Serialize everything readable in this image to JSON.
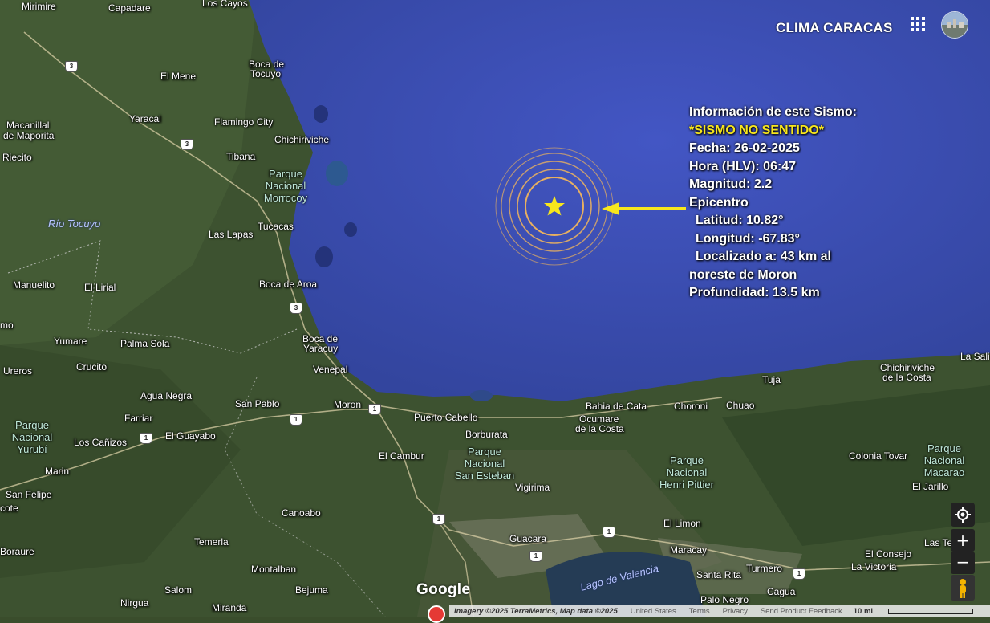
{
  "header": {
    "title": "CLIMA CARACAS"
  },
  "icons": {
    "apps": "apps-grid-icon",
    "avatar": "account-avatar",
    "locate": "my-location-icon",
    "zoom_in": "plus-icon",
    "zoom_out": "minus-icon",
    "street_view": "pegman-icon",
    "pin": "map-pin-icon"
  },
  "colors": {
    "sea": "#3b4fb8",
    "land": "#3a4d2c",
    "rings": "#e8b060",
    "star": "#f8e71c",
    "arrow": "#f8e71c",
    "highlight": "#f8e71c"
  },
  "quake": {
    "heading": "Información de este Sismo:",
    "felt": "*SISMO NO SENTIDO*",
    "date": "Fecha: 26-02-2025",
    "time": "Hora (HLV): 06:47",
    "magnitude": "Magnitud: 2.2",
    "epicenter": "Epicentro",
    "latitude": "Latitud: 10.82°",
    "longitude": "Longitud: -67.83°",
    "location_line1": "Localizado a: 43 km al",
    "location_line2": "noreste de Moron",
    "depth": "Profundidad: 13.5 km"
  },
  "places": [
    "Mirimire",
    "Capadare",
    "Los Cayos",
    "Boca de",
    "Tocuyo",
    "El Mene",
    "Macanillal",
    "de Maporita",
    "Yaracal",
    "Flamingo City",
    "Chichiriviche",
    "Riecito",
    "Tibana",
    "Las Lapas",
    "Tucacas",
    "Boca de Aroa",
    "Manuelito",
    "El Lirial",
    "Boca de",
    "Yaracuy",
    "Yumare",
    "Palma Sola",
    "Ureros",
    "Crucito",
    "Venepal",
    "Agua Negra",
    "San Pablo",
    "Moron",
    "Puerto Cabello",
    "Farriar",
    "El Guayabo",
    "Los Cañizos",
    "Borburata",
    "El Cambur",
    "Marin",
    "San Felipe",
    "Vigirima",
    "Canoabo",
    "Temerla",
    "Montalban",
    "Salom",
    "Bejuma",
    "Nirgua",
    "Miranda",
    "Guacara",
    "Maracay",
    "Santa Rita",
    "Turmero",
    "Palo Negro",
    "Cagua",
    "El Limon",
    "Bahia de Cata",
    "Ocumare",
    "de la Costa",
    "Choroni",
    "Chuao",
    "Tuja",
    "Chichiriviche",
    "de la Costa",
    "La Sali",
    "Colonia Tovar",
    "El Jarillo",
    "El Consejo",
    "La Victoria",
    "Las Te",
    "Boraure",
    "cote",
    "mo"
  ],
  "parks": {
    "morrocoy": [
      "Parque",
      "Nacional",
      "Morrocoy"
    ],
    "yurubi": [
      "Parque",
      "Nacional",
      "Yurubí"
    ],
    "san_esteban": [
      "Parque",
      "Nacional",
      "San Esteban"
    ],
    "henri_pittier": [
      "Parque",
      "Nacional",
      "Henri Pittier"
    ],
    "macarao": [
      "Parque",
      "Nacional",
      "Macarao"
    ]
  },
  "water_labels": {
    "river": "Río Tocuyo",
    "lake": "Lago de Valencia"
  },
  "routes": [
    "3",
    "3",
    "3",
    "1",
    "1",
    "1",
    "1",
    "1",
    "1",
    "1"
  ],
  "footer": {
    "brand": "Google",
    "imagery": "Imagery ©2025 TerraMetrics, Map data ©2025",
    "country": "United States",
    "terms": "Terms",
    "privacy": "Privacy",
    "feedback": "Send Product Feedback",
    "scale": "10 mi"
  }
}
